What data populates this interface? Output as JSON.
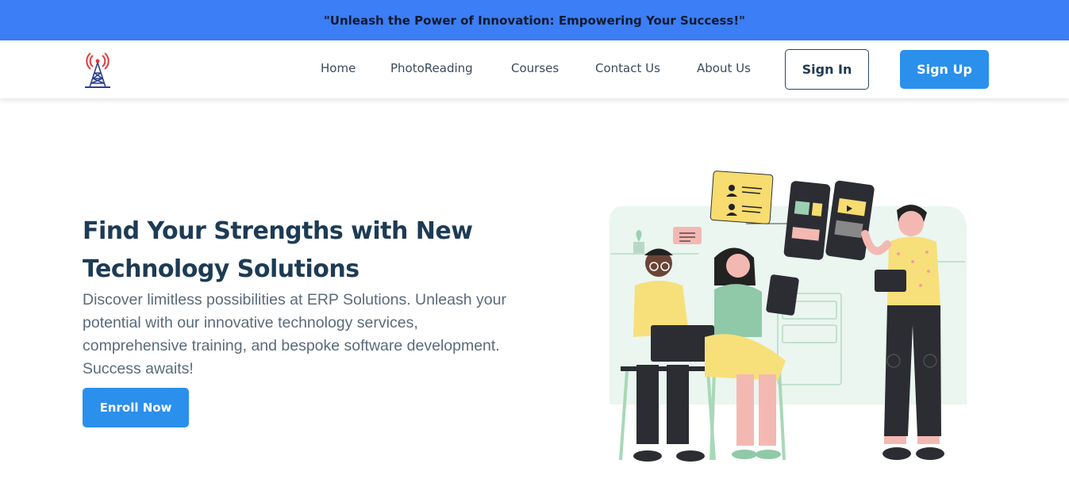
{
  "announcement": {
    "text": "\"Unleash the Power of Innovation: Empowering Your Success!\""
  },
  "nav": {
    "items": [
      {
        "label": "Home"
      },
      {
        "label": "PhotoReading"
      },
      {
        "label": "Courses"
      },
      {
        "label": "Contact Us"
      },
      {
        "label": "About Us"
      }
    ],
    "sign_in": "Sign In",
    "sign_up": "Sign Up"
  },
  "hero": {
    "title_line1": "Find Your Strengths with New",
    "title_line2": "Technology Solutions",
    "description": "Discover limitless possibilities at ERP Solutions. Unleash your potential with our innovative technology services, comprehensive training, and bespoke software development. Success awaits!",
    "cta": "Enroll Now"
  },
  "icons": {
    "logo": "radio-tower-icon"
  },
  "colors": {
    "banner": "#3b7ef5",
    "accent": "#2b8fec",
    "heading": "#1d3b55"
  }
}
